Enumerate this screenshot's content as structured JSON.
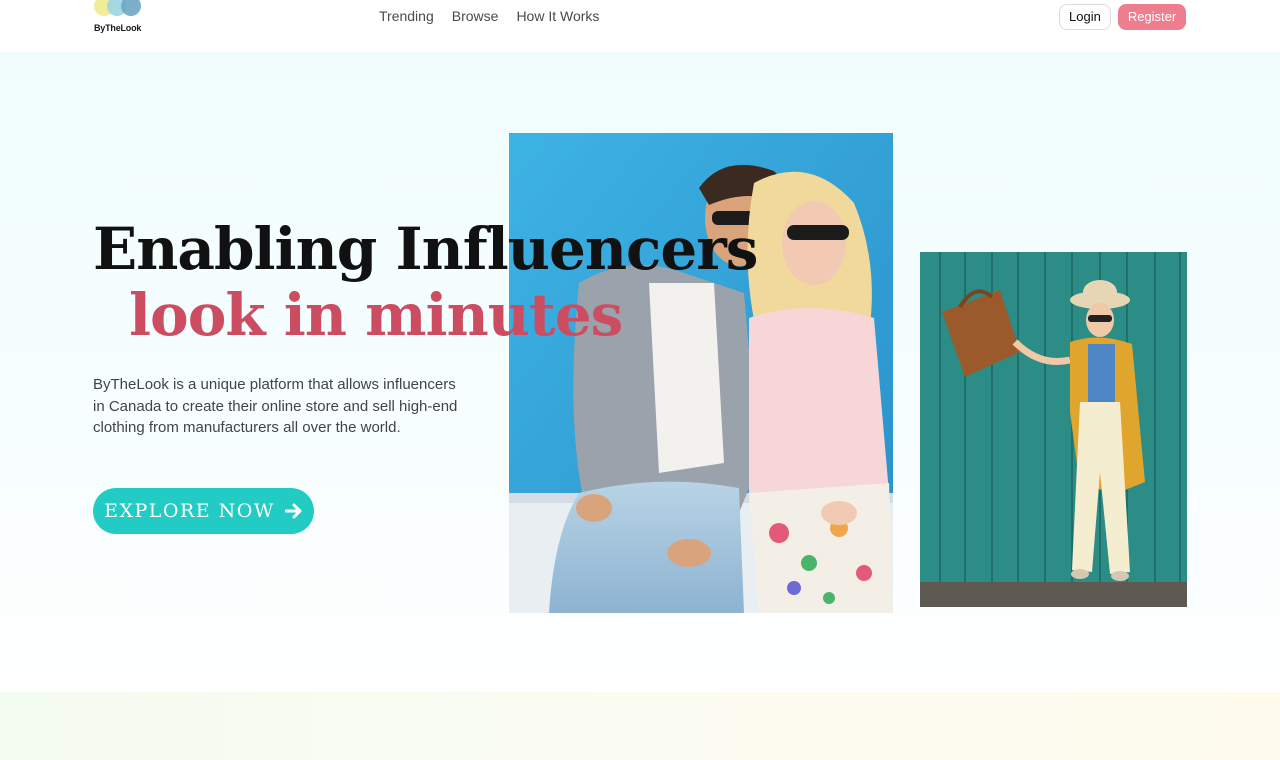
{
  "brand": {
    "name": "ByTheLook"
  },
  "nav": {
    "items": [
      {
        "label": "Trending"
      },
      {
        "label": "Browse"
      },
      {
        "label": "How It Works"
      }
    ]
  },
  "auth": {
    "login_label": "Login",
    "register_label": "Register"
  },
  "hero": {
    "headline_line1": "Enabling Influencers",
    "headline_line2": "look in minutes",
    "description": "ByTheLook is a unique platform that allows influencers in Canada to create their online store and sell high-end clothing from manufacturers all over the world.",
    "cta_label": "EXPLORE NOW",
    "cta_icon": "arrow-right-icon"
  },
  "colors": {
    "accent_teal": "#23cbc5",
    "accent_pink": "#ee7e8e",
    "headline_pink": "#cc4d62",
    "hero_background": "#f1fdfd"
  }
}
